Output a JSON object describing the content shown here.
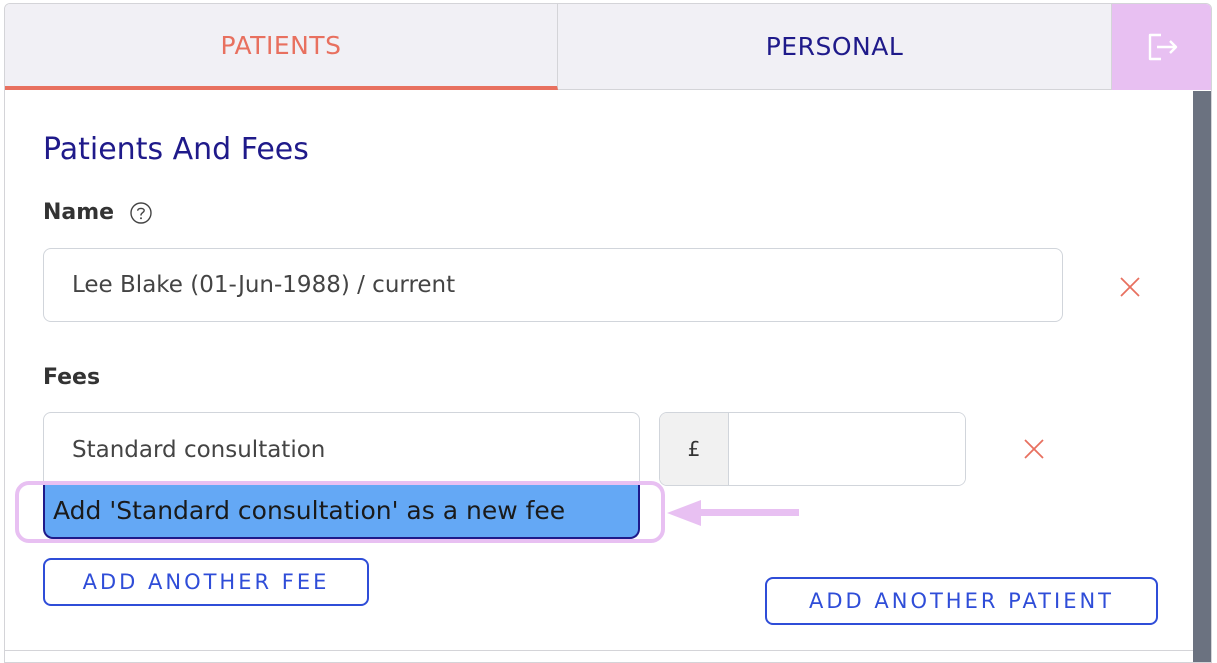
{
  "tabs": {
    "patients": "PATIENTS",
    "personal": "PERSONAL"
  },
  "icons": {
    "logout": "logout-icon",
    "help": "help-circle-icon",
    "remove": "close-icon",
    "arrow": "arrow-left-icon"
  },
  "section": {
    "title": "Patients And Fees"
  },
  "name": {
    "label": "Name",
    "value": "Lee Blake (01-Jun-1988) / current"
  },
  "fees": {
    "label": "Fees",
    "fee_value": "Standard consultation",
    "currency_symbol": "£",
    "amount_value": "",
    "suggestion": "Add 'Standard consultation' as a new fee"
  },
  "buttons": {
    "add_fee": "ADD ANOTHER FEE",
    "add_patient": "ADD ANOTHER PATIENT"
  },
  "colors": {
    "active_tab": "#e8705f",
    "primary": "#1f1a8a",
    "accent_button": "#2f4dd8",
    "highlight": "#e8c0f2",
    "suggestion_bg": "#64a8f5"
  }
}
